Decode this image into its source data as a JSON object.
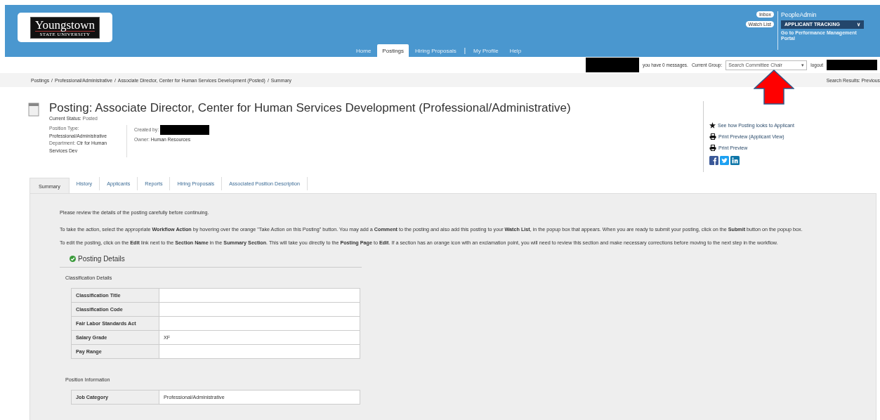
{
  "header": {
    "logo": {
      "name": "Youngstown",
      "sub": "STATE UNIVERSITY"
    },
    "nav": [
      {
        "label": "Home",
        "selected": false
      },
      {
        "label": "Postings",
        "selected": true
      },
      {
        "label": "Hiring Proposals",
        "selected": false
      },
      {
        "label": "|",
        "kind": "sep"
      },
      {
        "label": "My Profile",
        "selected": false
      },
      {
        "label": "Help",
        "selected": false
      }
    ],
    "pills": [
      "Inbox",
      "Watch List"
    ],
    "product": {
      "name": "PeopleAdmin",
      "module": "APPLICANT TRACKING",
      "caret": "∨",
      "link": "Go to Performance Management Portal"
    }
  },
  "user_bar": {
    "messages": "you have 0 messages.",
    "group_label": "Current Group:",
    "group_value": "Search Committee Chair",
    "group_caret": "▾",
    "logout": "logout"
  },
  "breadcrumb": {
    "separator": "/",
    "items": [
      "Postings",
      "Professional/Administrative",
      "Associate Director, Center for Human Services Development (Posted)",
      "Summary"
    ],
    "search_results": "Search Results: Previous"
  },
  "posting": {
    "title": "Posting: Associate Director, Center for Human Services Development (Professional/Administrative)",
    "status_label": "Current Status:",
    "status": "Posted",
    "position_type_label": "Position Type:",
    "position_type": "Professional/Administrative",
    "department_label": "Department:",
    "department": "Ctr for Human Services Dev",
    "created_label": "Created by:",
    "owner_label": "Owner:",
    "owner": "Human Resources",
    "actions": [
      {
        "kind": "star",
        "label": "See how Posting looks to Applicant"
      },
      {
        "kind": "print",
        "label": "Print Preview (Applicant View)"
      },
      {
        "kind": "print",
        "label": "Print Preview"
      }
    ]
  },
  "tabs": [
    {
      "label": "Summary",
      "selected": true
    },
    {
      "label": "History",
      "selected": false
    },
    {
      "label": "Applicants",
      "selected": false
    },
    {
      "label": "Reports",
      "selected": false
    },
    {
      "label": "Hiring Proposals",
      "selected": false
    },
    {
      "label": "Associated Position Description",
      "selected": false
    }
  ],
  "intro": [
    "Please review the details of the posting carefully before continuing.",
    "To take the action, select the appropriate **Workflow Action** by hovering over the orange \"Take Action on this Posting\" button. You may add a **Comment** to the posting and also add this posting to your **Watch List**, in the popup box that appears. When you are ready to submit your posting, click on the **Submit** button on the popup box.",
    "To edit the posting, click on the **Edit** link next to the **Section Name** in the **Summary Section**. This will take you directly to the **Posting Page** to **Edit**. If a section has an orange icon with an exclamation point, you will need to review this section and make necessary corrections before moving to the next step in the workflow."
  ],
  "section": {
    "title": "Posting Details",
    "groups": [
      {
        "title": "Classification Details",
        "rows": [
          {
            "label": "Classification Title",
            "value": ""
          },
          {
            "label": "Classification Code",
            "value": ""
          },
          {
            "label": "Fair Labor Standards Act",
            "value": ""
          },
          {
            "label": "Salary Grade",
            "value": "XF"
          },
          {
            "label": "Pay Range",
            "value": ""
          }
        ]
      },
      {
        "title": "Position Information",
        "rows": [
          {
            "label": "Job Category",
            "value": "Professional/Administrative"
          }
        ]
      }
    ]
  }
}
